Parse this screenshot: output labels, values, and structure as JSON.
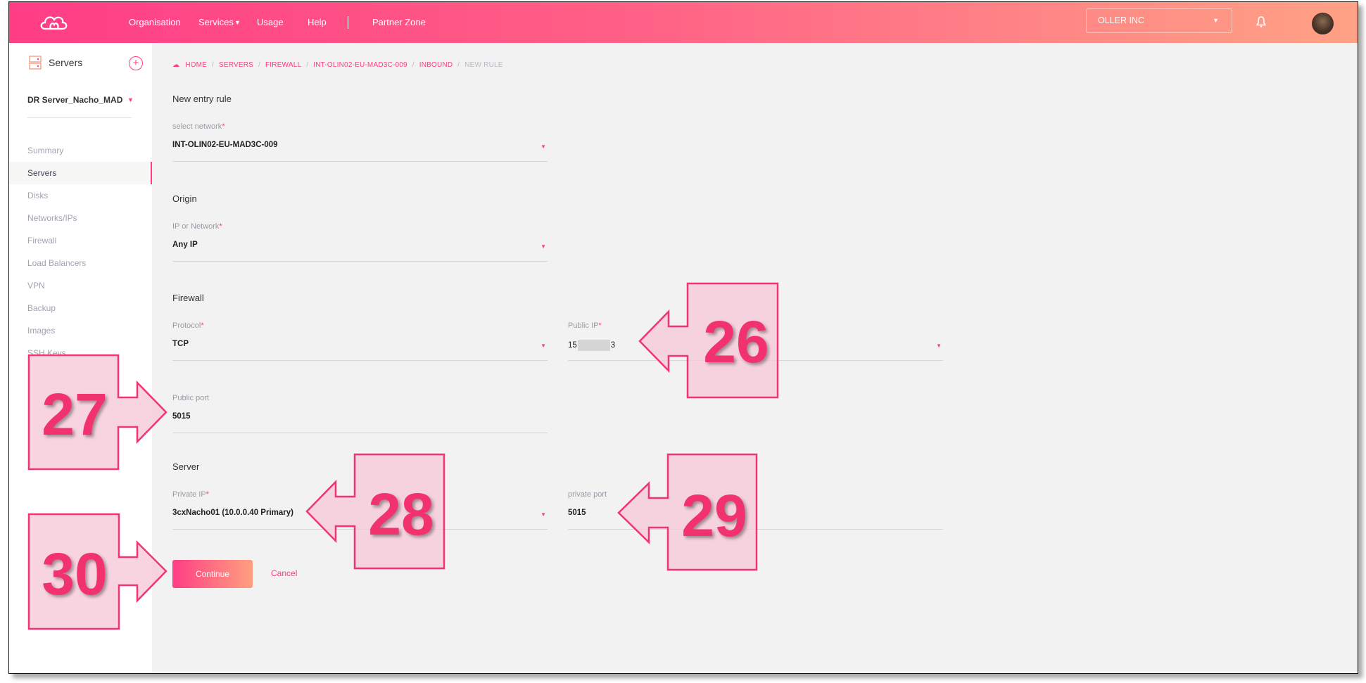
{
  "header": {
    "nav": [
      "Organisation",
      "Services",
      "Usage",
      "Help",
      "Partner Zone"
    ],
    "company": "OLLER INC"
  },
  "sidebar": {
    "title": "Servers",
    "add_label": "+",
    "server_select": "DR Server_Nacho_MAD",
    "items": [
      {
        "label": "Summary"
      },
      {
        "label": "Servers",
        "active": true
      },
      {
        "label": "Disks"
      },
      {
        "label": "Networks/IPs"
      },
      {
        "label": "Firewall"
      },
      {
        "label": "Load Balancers"
      },
      {
        "label": "VPN"
      },
      {
        "label": "Backup"
      },
      {
        "label": "Images"
      },
      {
        "label": "SSH Keys"
      }
    ]
  },
  "breadcrumb": [
    "HOME",
    "SERVERS",
    "FIREWALL",
    "INT-OLIN02-EU-MAD3C-009",
    "INBOUND",
    "NEW RULE"
  ],
  "form": {
    "title": "New entry rule",
    "network": {
      "label": "select network",
      "value": "INT-OLIN02-EU-MAD3C-009"
    },
    "origin_title": "Origin",
    "ip_or_network": {
      "label": "IP or Network",
      "value": "Any IP"
    },
    "firewall_title": "Firewall",
    "protocol": {
      "label": "Protocol",
      "value": "TCP"
    },
    "public_ip": {
      "label": "Public IP",
      "value_prefix": "15",
      "value_suffix": "3"
    },
    "public_port": {
      "label": "Public port",
      "value": "5015"
    },
    "server_title": "Server",
    "private_ip": {
      "label": "Private IP",
      "value": "3cxNacho01 (10.0.0.40 Primary)"
    },
    "private_port": {
      "label": "private port",
      "value": "5015"
    },
    "required_mark": "*",
    "continue": "Continue",
    "cancel": "Cancel"
  },
  "annotations": [
    "26",
    "27",
    "28",
    "29",
    "30"
  ],
  "colors": {
    "accent": "#ff3d7f",
    "header_start": "#ff3d86",
    "header_end": "#ffa285",
    "callout_stroke": "#f23571"
  }
}
